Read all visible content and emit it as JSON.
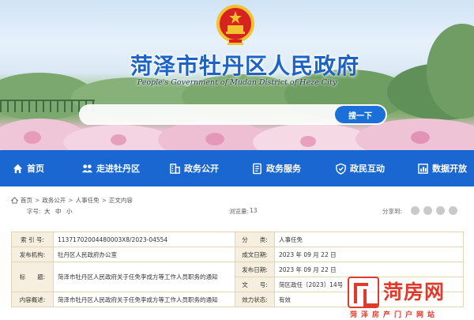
{
  "header": {
    "site_title": "菏泽市牡丹区人民政府",
    "site_subtitle": "People's Government of Mudan District of Heze City",
    "search_placeholder": "",
    "search_button": "搜一下"
  },
  "nav": {
    "items": [
      {
        "label": "首页",
        "icon": "home-icon"
      },
      {
        "label": "走进牡丹区",
        "icon": "people-icon"
      },
      {
        "label": "政务公开",
        "icon": "building-icon"
      },
      {
        "label": "政务服务",
        "icon": "document-icon"
      },
      {
        "label": "政民互动",
        "icon": "shield-icon"
      },
      {
        "label": "数据开放",
        "icon": "chart-icon"
      }
    ]
  },
  "breadcrumb": [
    "首页",
    "政务公开",
    "人事任免",
    "正文内容"
  ],
  "toolbar": {
    "font_label": "字号:",
    "font_sizes": [
      "大",
      "中",
      "小"
    ],
    "views_label": "浏览量:",
    "views_count": "13",
    "share_label": "分享到:"
  },
  "info": {
    "index_label": "索 引 号:",
    "index_value": "11371702004480003X8/2023-04554",
    "category_label": "分　　类:",
    "category_value": "人事任免",
    "agency_label": "发布机构:",
    "agency_value": "牡丹区人民政府办公室",
    "created_label": "成文日期:",
    "created_value": "2023 年 09 月 22 日",
    "title_label": "标　　题:",
    "title_value": "菏泽市牡丹区人民政府关于任免李成方等工作人员职务的通知",
    "published_label": "发布日期:",
    "published_value": "2023 年 09 月 22 日",
    "docno_label": "文　　号:",
    "docno_value": "菏区政任〔2023〕14号",
    "summary_label": "内容概述:",
    "summary_value": "菏泽市牡丹区人民政府关于任免李成方等工作人员职务的通知",
    "status_label": "效力状态:",
    "status_value": "有效"
  },
  "watermark": {
    "brand": "菏房网",
    "slogan": "菏泽房产门户网站"
  },
  "colors": {
    "primary_blue": "#1b67d2",
    "title_blue": "#1e63c4",
    "table_label_bg": "#f6efdf",
    "table_border": "#e2d5b6",
    "watermark_red": "#e03a2d"
  }
}
